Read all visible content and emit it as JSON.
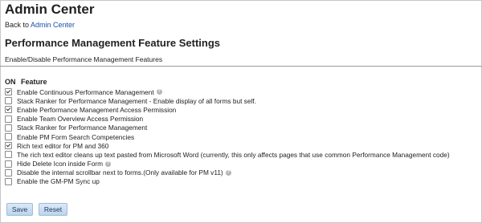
{
  "header": {
    "title": "Admin Center",
    "back_prefix": "Back to",
    "back_link": "Admin Center"
  },
  "section": {
    "title": "Performance Management Feature Settings",
    "subtitle": "Enable/Disable Performance Management Features"
  },
  "columns": {
    "on": "ON",
    "feature": "Feature"
  },
  "features": [
    {
      "label": "Enable Continuous Performance Management",
      "checked": true,
      "help": true
    },
    {
      "label": "Stack Ranker for Performance Management - Enable display of all forms but self.",
      "checked": false,
      "help": false
    },
    {
      "label": "Enable Performance Management Access Permission",
      "checked": true,
      "help": false
    },
    {
      "label": "Enable Team Overview Access Permission",
      "checked": false,
      "help": false
    },
    {
      "label": "Stack Ranker for Performance Management",
      "checked": false,
      "help": false
    },
    {
      "label": "Enable PM Form Search Competencies",
      "checked": false,
      "help": false
    },
    {
      "label": "Rich text editor for PM and 360",
      "checked": true,
      "help": false
    },
    {
      "label": "The rich text editor cleans up text pasted from Microsoft Word (currently, this only affects pages that use common Performance Management code)",
      "checked": false,
      "help": false
    },
    {
      "label": "Hide Delete Icon inside Form",
      "checked": false,
      "help": true
    },
    {
      "label": "Disable the internal scrollbar next to forms.(Only available for PM v11)",
      "checked": false,
      "help": true
    },
    {
      "label": "Enable the GM-PM Sync up",
      "checked": false,
      "help": false
    }
  ],
  "buttons": {
    "save": "Save",
    "reset": "Reset"
  }
}
